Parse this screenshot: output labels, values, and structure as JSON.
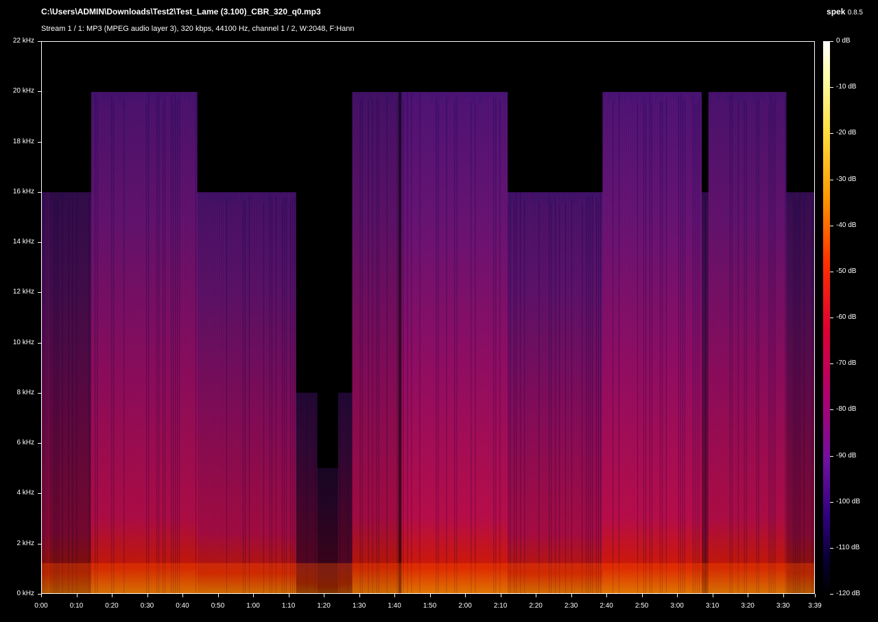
{
  "header": {
    "file_path": "C:\\Users\\ADMIN\\Downloads\\Test2\\Test_Lame (3.100)_CBR_320_q0.mp3",
    "app_name": "spek",
    "app_version": "0.8.5",
    "stream_info": "Stream 1 / 1: MP3 (MPEG audio layer 3), 320 kbps, 44100 Hz, channel 1 / 2, W:2048, F:Hann"
  },
  "freq_axis": {
    "labels": [
      "22 kHz",
      "20 kHz",
      "18 kHz",
      "16 kHz",
      "14 kHz",
      "12 kHz",
      "10 kHz",
      "8 kHz",
      "6 kHz",
      "4 kHz",
      "2 kHz",
      "0 kHz"
    ],
    "values_khz": [
      22,
      20,
      18,
      16,
      14,
      12,
      10,
      8,
      6,
      4,
      2,
      0
    ]
  },
  "time_axis": {
    "labels": [
      "0:00",
      "0:10",
      "0:20",
      "0:30",
      "0:40",
      "0:50",
      "1:00",
      "1:10",
      "1:20",
      "1:30",
      "1:40",
      "1:50",
      "2:00",
      "2:10",
      "2:20",
      "2:30",
      "2:40",
      "2:50",
      "3:00",
      "3:10",
      "3:20",
      "3:30",
      "3:39"
    ],
    "values_sec": [
      0,
      10,
      20,
      30,
      40,
      50,
      60,
      70,
      80,
      90,
      100,
      110,
      120,
      130,
      140,
      150,
      160,
      170,
      180,
      190,
      200,
      210,
      219
    ]
  },
  "color_scale": {
    "labels": [
      "0 dB",
      "-10 dB",
      "-20 dB",
      "-30 dB",
      "-40 dB",
      "-50 dB",
      "-60 dB",
      "-70 dB",
      "-80 dB",
      "-90 dB",
      "-100 dB",
      "-110 dB",
      "-120 dB"
    ],
    "values_db": [
      0,
      -10,
      -20,
      -30,
      -40,
      -50,
      -60,
      -70,
      -80,
      -90,
      -100,
      -110,
      -120
    ]
  },
  "spectrogram": {
    "duration_sec": 219,
    "max_khz": 22,
    "segments": [
      {
        "t0": 0,
        "t1": 2,
        "cutoff_khz": 16,
        "level": 0.55
      },
      {
        "t0": 2,
        "t1": 14,
        "cutoff_khz": 16,
        "level": 0.5
      },
      {
        "t0": 14,
        "t1": 44,
        "cutoff_khz": 20,
        "level": 0.75
      },
      {
        "t0": 44,
        "t1": 72,
        "cutoff_khz": 16,
        "level": 0.7
      },
      {
        "t0": 72,
        "t1": 78,
        "cutoff_khz": 8,
        "level": 0.35
      },
      {
        "t0": 78,
        "t1": 84,
        "cutoff_khz": 5,
        "level": 0.25
      },
      {
        "t0": 84,
        "t1": 88,
        "cutoff_khz": 8,
        "level": 0.35
      },
      {
        "t0": 88,
        "t1": 101,
        "cutoff_khz": 20,
        "level": 0.7
      },
      {
        "t0": 101,
        "t1": 102,
        "cutoff_khz": 20,
        "level": 0.3
      },
      {
        "t0": 102,
        "t1": 132,
        "cutoff_khz": 20,
        "level": 0.8
      },
      {
        "t0": 132,
        "t1": 159,
        "cutoff_khz": 16,
        "level": 0.72
      },
      {
        "t0": 159,
        "t1": 187,
        "cutoff_khz": 20,
        "level": 0.8
      },
      {
        "t0": 187,
        "t1": 189,
        "cutoff_khz": 16,
        "level": 0.5
      },
      {
        "t0": 189,
        "t1": 211,
        "cutoff_khz": 20,
        "level": 0.75
      },
      {
        "t0": 211,
        "t1": 219,
        "cutoff_khz": 16,
        "level": 0.55
      }
    ]
  }
}
